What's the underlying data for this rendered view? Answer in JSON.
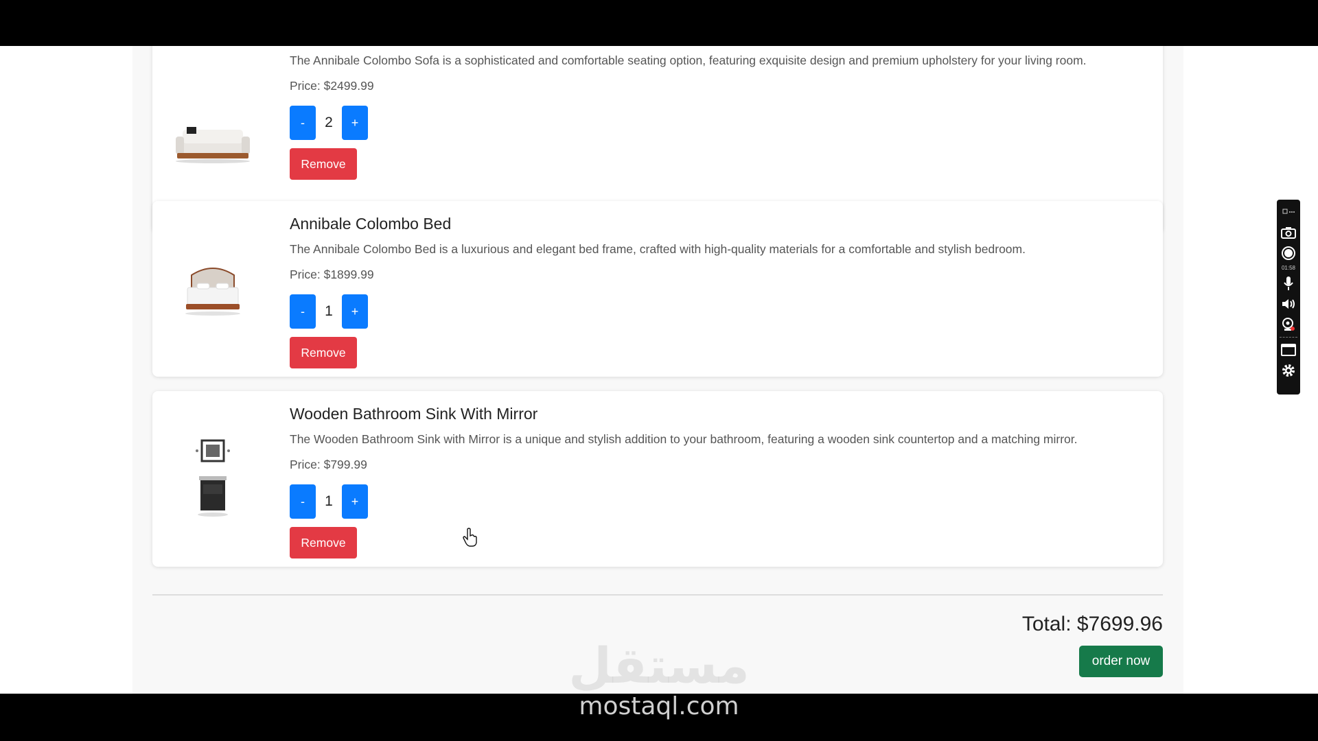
{
  "cart": {
    "items": [
      {
        "name": "",
        "description": "The Annibale Colombo Sofa is a sophisticated and comfortable seating option, featuring exquisite design and premium upholstery for your living room.",
        "price": "Price: $2499.99",
        "quantity": "2",
        "decrement_label": "-",
        "increment_label": "+",
        "remove_label": "Remove",
        "image_icon": "sofa-image"
      },
      {
        "name": "Annibale Colombo Bed",
        "description": "The Annibale Colombo Bed is a luxurious and elegant bed frame, crafted with high-quality materials for a comfortable and stylish bedroom.",
        "price": "Price: $1899.99",
        "quantity": "1",
        "decrement_label": "-",
        "increment_label": "+",
        "remove_label": "Remove",
        "image_icon": "bed-image"
      },
      {
        "name": "Wooden Bathroom Sink With Mirror",
        "description": "The Wooden Bathroom Sink with Mirror is a unique and stylish addition to your bathroom, featuring a wooden sink countertop and a matching mirror.",
        "price": "Price: $799.99",
        "quantity": "1",
        "decrement_label": "-",
        "increment_label": "+",
        "remove_label": "Remove",
        "image_icon": "bathroom-sink-image"
      }
    ],
    "total": "Total: $7699.96",
    "order_label": "order now"
  },
  "recorder_toolbar": {
    "timer": "01:58",
    "icons": [
      "expand-icon",
      "camera-icon",
      "record-icon",
      "microphone-icon",
      "speaker-icon",
      "webcam-icon",
      "screen-icon",
      "gear-icon"
    ]
  },
  "watermark": {
    "logo_text": "مستقل",
    "url": "mostaql.com"
  },
  "colors": {
    "primary_button": "#0a7bff",
    "remove_button": "#e33a44",
    "order_button": "#167a4a"
  }
}
